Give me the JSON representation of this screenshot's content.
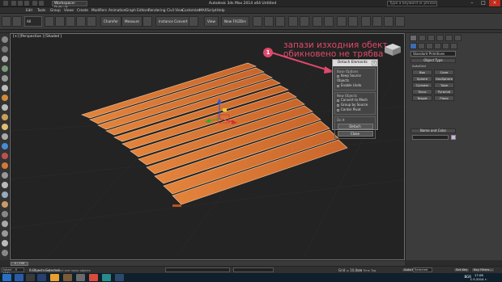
{
  "titlebar": {
    "workspace": "Workspace: Default",
    "title": "Autodesk 3ds Max 2014 x64    Untitled",
    "search_placeholder": "Type a keyword or phrase"
  },
  "menu": [
    "Edit",
    "Tools",
    "Group",
    "Views",
    "Create",
    "Modifiers",
    "Animation",
    "Graph Editors",
    "Rendering",
    "Civil View",
    "Customize",
    "MAXScript",
    "Help"
  ],
  "toolbar": {
    "filter": "All",
    "btn1": "Chamfer",
    "btn2": "Measure",
    "btn3": "Instance Convert",
    "view": "View",
    "btn4": "New FX/ZBrs"
  },
  "viewport": {
    "label": "[+] [Perspective ] [Shaded ]"
  },
  "annotation": {
    "badge": "1",
    "line1": "запази изходния обект",
    "line2": "обикновено не трябва"
  },
  "dialog": {
    "title": "Detach Elements",
    "group1_title": "Base Options",
    "opt1": "Keep Source Objects",
    "opt2": "Enable Undo",
    "group2_title": "New Objects",
    "opt3": "Convert to Mesh",
    "opt4": "Group by Source",
    "opt5": "Center Pivot",
    "group3_title": "Do It",
    "btn1": "Detach",
    "btn2": "Close"
  },
  "command_panel": {
    "dropdown": "Standard Primitives",
    "rollout1": "Object Type",
    "autogrid": "AutoGrid",
    "buttons": [
      "Box",
      "Cone",
      "Sphere",
      "GeoSphere",
      "Cylinder",
      "Tube",
      "Torus",
      "Pyramid",
      "Teapot",
      "Plane"
    ],
    "rollout2": "Name and Color"
  },
  "timeslider": {
    "label": "0 / 100"
  },
  "status": {
    "maxscript": "Isbarr - 0 (14)",
    "selected": "0 Objects Selected",
    "prompt": "Click and drag to select and move objects",
    "grid": "Grid = 10,0cm",
    "add_time_tag": "Add Time Tag",
    "autokey": "Auto Key",
    "selected_dd": "Selected",
    "setkey": "Set Key",
    "keyfilters": "Key Filters..."
  },
  "taskbar": {
    "lang": "BGR",
    "time": "17:06",
    "date": "1.5.2014 г."
  },
  "colors": {
    "annotation": "#e04a6a",
    "wood": "#d9742e",
    "gizmo_y": "#2ea82e",
    "gizmo_z": "#2f56d8",
    "gizmo_x": "#d83030"
  }
}
